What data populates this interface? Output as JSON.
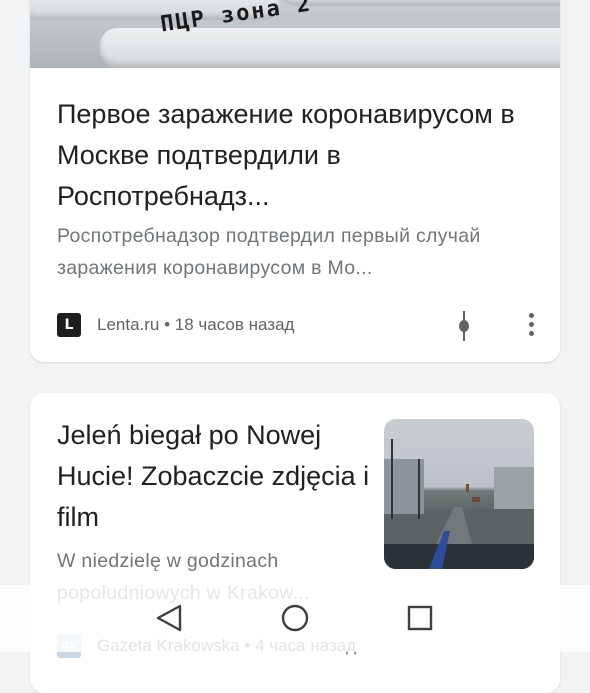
{
  "feed": {
    "articles": [
      {
        "image_text": "ПЦР зона 2",
        "title": "Первое заражение коронавирусом в Москве подтвердили в Роспотребнадз...",
        "snippet": "Роспотребнадзор подтвердил первый случай заражения коронавирусом в Мо...",
        "source_logo": "L",
        "source": "Lenta.ru • 18 часов назад"
      },
      {
        "title": "Jeleń biegał po Nowej Hucie! Zobaczcie zdjęcia i film",
        "snippet": "W niedzielę w godzinach popołudniowych w Krakow...",
        "source_logo": "GK",
        "source": "Gazeta Krakowska • 4 часа назад"
      }
    ]
  },
  "navbar": {
    "buttons": [
      "back-icon",
      "home-icon",
      "recents-icon"
    ]
  },
  "colors": {
    "title": "#202124",
    "snippet": "#70757a",
    "meta": "#5f6368",
    "background": "#f1f3f4"
  }
}
